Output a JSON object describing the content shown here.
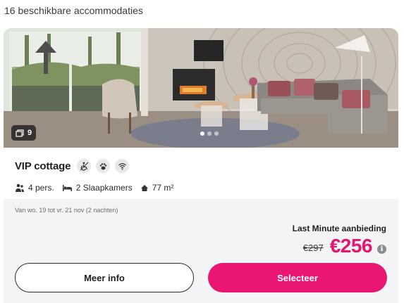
{
  "results": {
    "count_text": "16 beschikbare accommodaties"
  },
  "card": {
    "photo": {
      "count": "9",
      "slides": 3,
      "active_slide": 1,
      "image": "living-room-with-fireplace-and-lamp"
    },
    "title": "VIP cottage",
    "amenities": [
      {
        "icon": "wheelchair-icon",
        "label": "wheelchair accessible"
      },
      {
        "icon": "paw-icon",
        "label": "pets allowed"
      },
      {
        "icon": "wifi-icon",
        "label": "wifi"
      }
    ],
    "specs": {
      "persons": "4 pers.",
      "bedrooms": "2 Slaapkamers",
      "area": "77 m²"
    },
    "dates": "Van wo. 19 tot vr. 21 nov (2 nachten)",
    "price": {
      "deal_label": "Last Minute aanbieding",
      "old": "€297",
      "new": "€256"
    },
    "buttons": {
      "more_info": "Meer info",
      "select": "Selecteer"
    }
  },
  "colors": {
    "accent": "#ea1673",
    "price": "#e6156e"
  }
}
